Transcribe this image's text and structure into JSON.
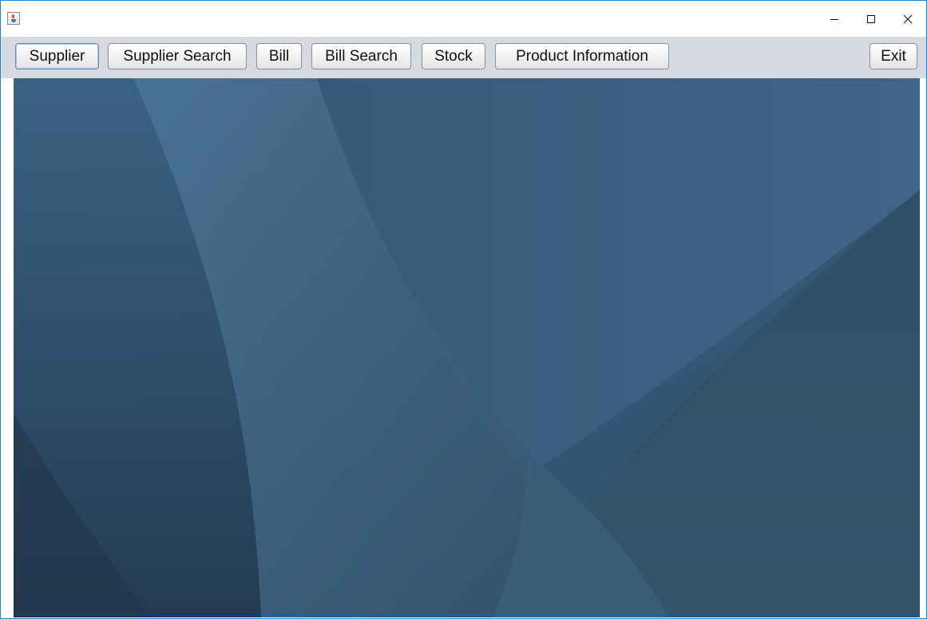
{
  "window": {
    "title": "",
    "icon": "java-cup-icon",
    "controls": [
      "minimize-icon",
      "maximize-icon",
      "close-icon"
    ]
  },
  "toolbar": {
    "buttons": [
      {
        "label": "Supplier"
      },
      {
        "label": "Supplier Search"
      },
      {
        "label": "Bill"
      },
      {
        "label": "Bill Search"
      },
      {
        "label": "Stock"
      },
      {
        "label": "Product Information"
      }
    ],
    "exit_label": "Exit"
  },
  "colors": {
    "toolbar_background": "#d6d9df",
    "desktop_base": "#345a76",
    "window_border": "#1883d7"
  }
}
